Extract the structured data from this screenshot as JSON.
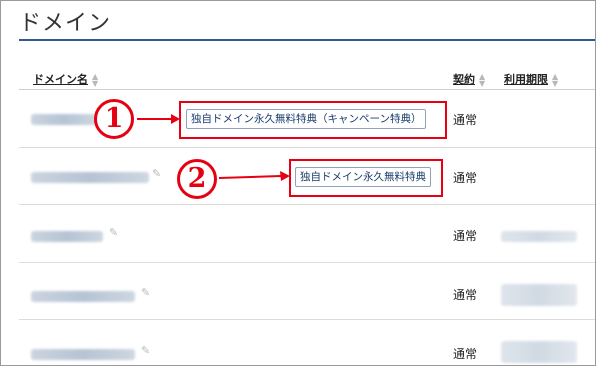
{
  "page": {
    "title": "ドメイン"
  },
  "table": {
    "headers": {
      "domain_name": "ドメイン名",
      "contract": "契約",
      "usage_period": "利用期限"
    },
    "rows": [
      {
        "contract": "通常",
        "badge": "独自ドメイン永久無料特典（キャンペーン特典）"
      },
      {
        "contract": "通常",
        "badge": "独自ドメイン永久無料特典"
      },
      {
        "contract": "通常"
      },
      {
        "contract": "通常"
      },
      {
        "contract": "通常"
      }
    ]
  },
  "annotations": {
    "marker_1": "1",
    "marker_2": "2"
  },
  "colors": {
    "highlight": "#e60012",
    "title_rule": "#2f5a8c",
    "badge_text": "#1a3c6e"
  },
  "icons": {
    "edit": "pencil-icon",
    "sort": "sort-icon"
  }
}
